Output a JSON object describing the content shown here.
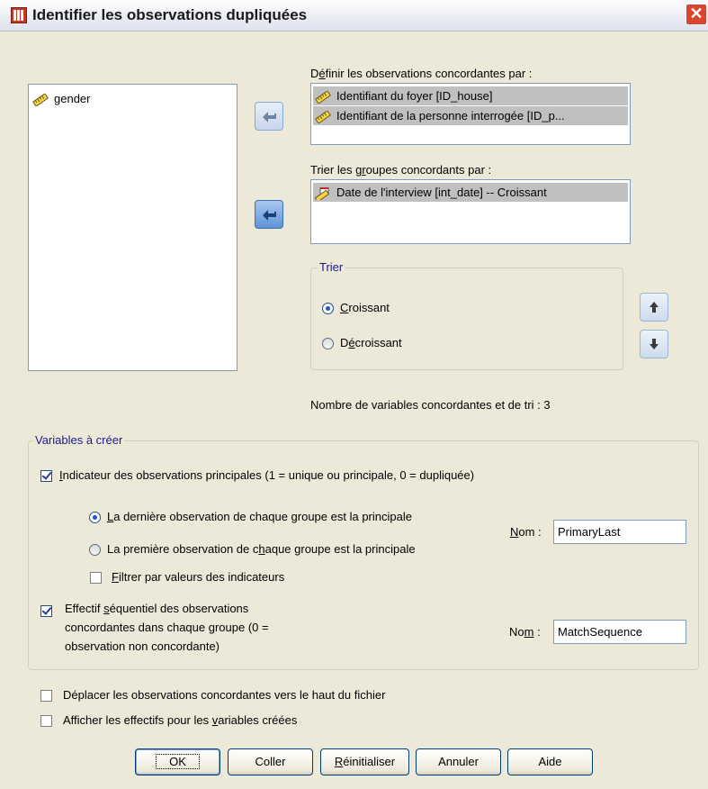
{
  "window": {
    "title": "Identifier les observations dupliquées",
    "close_glyph": "✕"
  },
  "source_list": {
    "items": [
      {
        "label": "gender",
        "icon": "ruler-icon"
      }
    ]
  },
  "match_by": {
    "label_pre": "D",
    "label_mnemonic": "é",
    "label_post": "finir les observations concordantes par :",
    "items": [
      {
        "label": "Identifiant du foyer [ID_house]",
        "icon": "ruler-icon"
      },
      {
        "label": "Identifiant de la personne interrogée [ID_p...",
        "icon": "ruler-icon"
      }
    ]
  },
  "sort_by": {
    "label_pre": "Trier les g",
    "label_mnemonic": "r",
    "label_post": "oupes concordants par :",
    "items": [
      {
        "label": "Date de l'interview [int_date] -- Croissant",
        "icon": "date-scale-icon"
      }
    ]
  },
  "sort_order": {
    "legend": "Trier",
    "ascending_mnemonic": "C",
    "ascending_rest": "roissant",
    "descending_pre": "D",
    "descending_mnemonic": "é",
    "descending_rest": "croissant",
    "selected": "Croissant"
  },
  "count_label": "Nombre de variables concordantes et de tri :  3",
  "variables": {
    "legend": "Variables à créer",
    "primary_indicator": {
      "checked": true,
      "mnemonic": "I",
      "label_rest": "ndicateur des observations principales (1 = unique ou principale, 0 = dupliquée)"
    },
    "last_option": {
      "mnemonic": "L",
      "rest": "a dernière observation de chaque groupe est la principale",
      "selected": true
    },
    "first_option": {
      "pre": "La première observation de c",
      "mnemonic": "h",
      "post": "aque groupe est la principale",
      "selected": false
    },
    "filter": {
      "checked": false,
      "mnemonic": "F",
      "rest": "iltrer par valeurs des indicateurs"
    },
    "name1_label_mn": "N",
    "name1_label_rest": "om :",
    "name1_value": "PrimaryLast",
    "sequential": {
      "checked": true,
      "line1_pre": "Effectif ",
      "line1_mn": "s",
      "line1_post": "équentiel des observations",
      "line2": "concordantes dans chaque groupe (0 =",
      "line3": "observation non concordante)"
    },
    "name2_label_pre": "No",
    "name2_label_mn": "m",
    "name2_label_post": " :",
    "name2_value": "MatchSequence"
  },
  "move_top": {
    "checked": false,
    "label": "Déplacer les observations concordantes vers le haut du fichier"
  },
  "show_counts": {
    "checked": false,
    "pre": "Afficher les effectifs pour les ",
    "mn": "v",
    "post": "ariables créées"
  },
  "buttons": {
    "ok": "OK",
    "paste": "Coller",
    "reset_mn": "R",
    "reset_rest": "éinitialiser",
    "cancel": "Annuler",
    "help": "Aide"
  }
}
